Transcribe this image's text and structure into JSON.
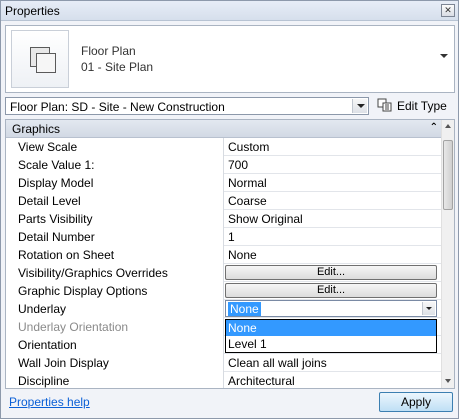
{
  "window": {
    "title": "Properties",
    "close_glyph": "✕"
  },
  "type_panel": {
    "line1": "Floor Plan",
    "line2": "01 - Site Plan",
    "icon": "floor-plan-icon"
  },
  "instance_selector": {
    "value": "Floor Plan: SD - Site - New Construction"
  },
  "edit_type": {
    "label": "Edit Type",
    "icon": "edit-type-icon"
  },
  "group": {
    "name": "Graphics",
    "collapse_glyph": "⌃"
  },
  "properties": [
    {
      "name": "View Scale",
      "value": "Custom",
      "kind": "text"
    },
    {
      "name": "Scale Value    1:",
      "value": "700",
      "kind": "text"
    },
    {
      "name": "Display Model",
      "value": "Normal",
      "kind": "text"
    },
    {
      "name": "Detail Level",
      "value": "Coarse",
      "kind": "text"
    },
    {
      "name": "Parts Visibility",
      "value": "Show Original",
      "kind": "text"
    },
    {
      "name": "Detail Number",
      "value": "1",
      "kind": "text"
    },
    {
      "name": "Rotation on Sheet",
      "value": "None",
      "kind": "text"
    },
    {
      "name": "Visibility/Graphics Overrides",
      "value": "Edit...",
      "kind": "button"
    },
    {
      "name": "Graphic Display Options",
      "value": "Edit...",
      "kind": "button"
    },
    {
      "name": "Underlay",
      "value": "None",
      "kind": "combo"
    },
    {
      "name": "Underlay Orientation",
      "value": "",
      "kind": "disabled"
    },
    {
      "name": "Orientation",
      "value": "",
      "kind": "text"
    },
    {
      "name": "Wall Join Display",
      "value": "Clean all wall joins",
      "kind": "text"
    },
    {
      "name": "Discipline",
      "value": "Architectural",
      "kind": "text"
    }
  ],
  "dropdown": {
    "options": [
      "None",
      "Level 1"
    ],
    "selected": "None"
  },
  "footer": {
    "help_link": "Properties help",
    "apply_label": "Apply"
  },
  "colors": {
    "selection": "#3399ff",
    "link": "#0a5fd6"
  }
}
